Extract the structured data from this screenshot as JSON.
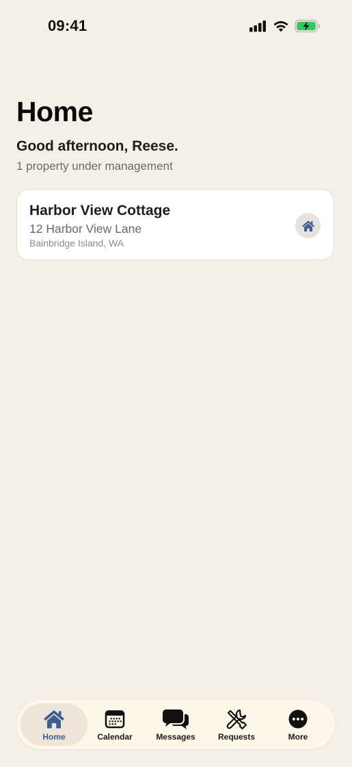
{
  "status_bar": {
    "time": "09:41",
    "icons": [
      "cellular-signal-icon",
      "wifi-icon",
      "battery-charging-icon"
    ],
    "battery_color": "#34C759"
  },
  "header": {
    "title": "Home"
  },
  "greeting": {
    "text": "Good afternoon, Reese.",
    "subtext": "1 property under management"
  },
  "properties": [
    {
      "name": "Harbor View Cottage",
      "address": "12 Harbor View Lane",
      "city": "Bainbridge Island, WA",
      "icon": "house-icon"
    }
  ],
  "tab_bar": {
    "active_tab": "Home",
    "tabs": [
      {
        "label": "Home",
        "icon": "house-icon"
      },
      {
        "label": "Calendar",
        "icon": "calendar-icon"
      },
      {
        "label": "Messages",
        "icon": "messages-icon"
      },
      {
        "label": "Requests",
        "icon": "tools-icon"
      },
      {
        "label": "More",
        "icon": "more-icon"
      }
    ]
  },
  "colors": {
    "background": "#F4EFE7",
    "accent": "#3B5F94",
    "card": "#FFFFFF",
    "tab_bar": "#FCF7E8",
    "active_tab_bg": "#EDE6D8"
  }
}
